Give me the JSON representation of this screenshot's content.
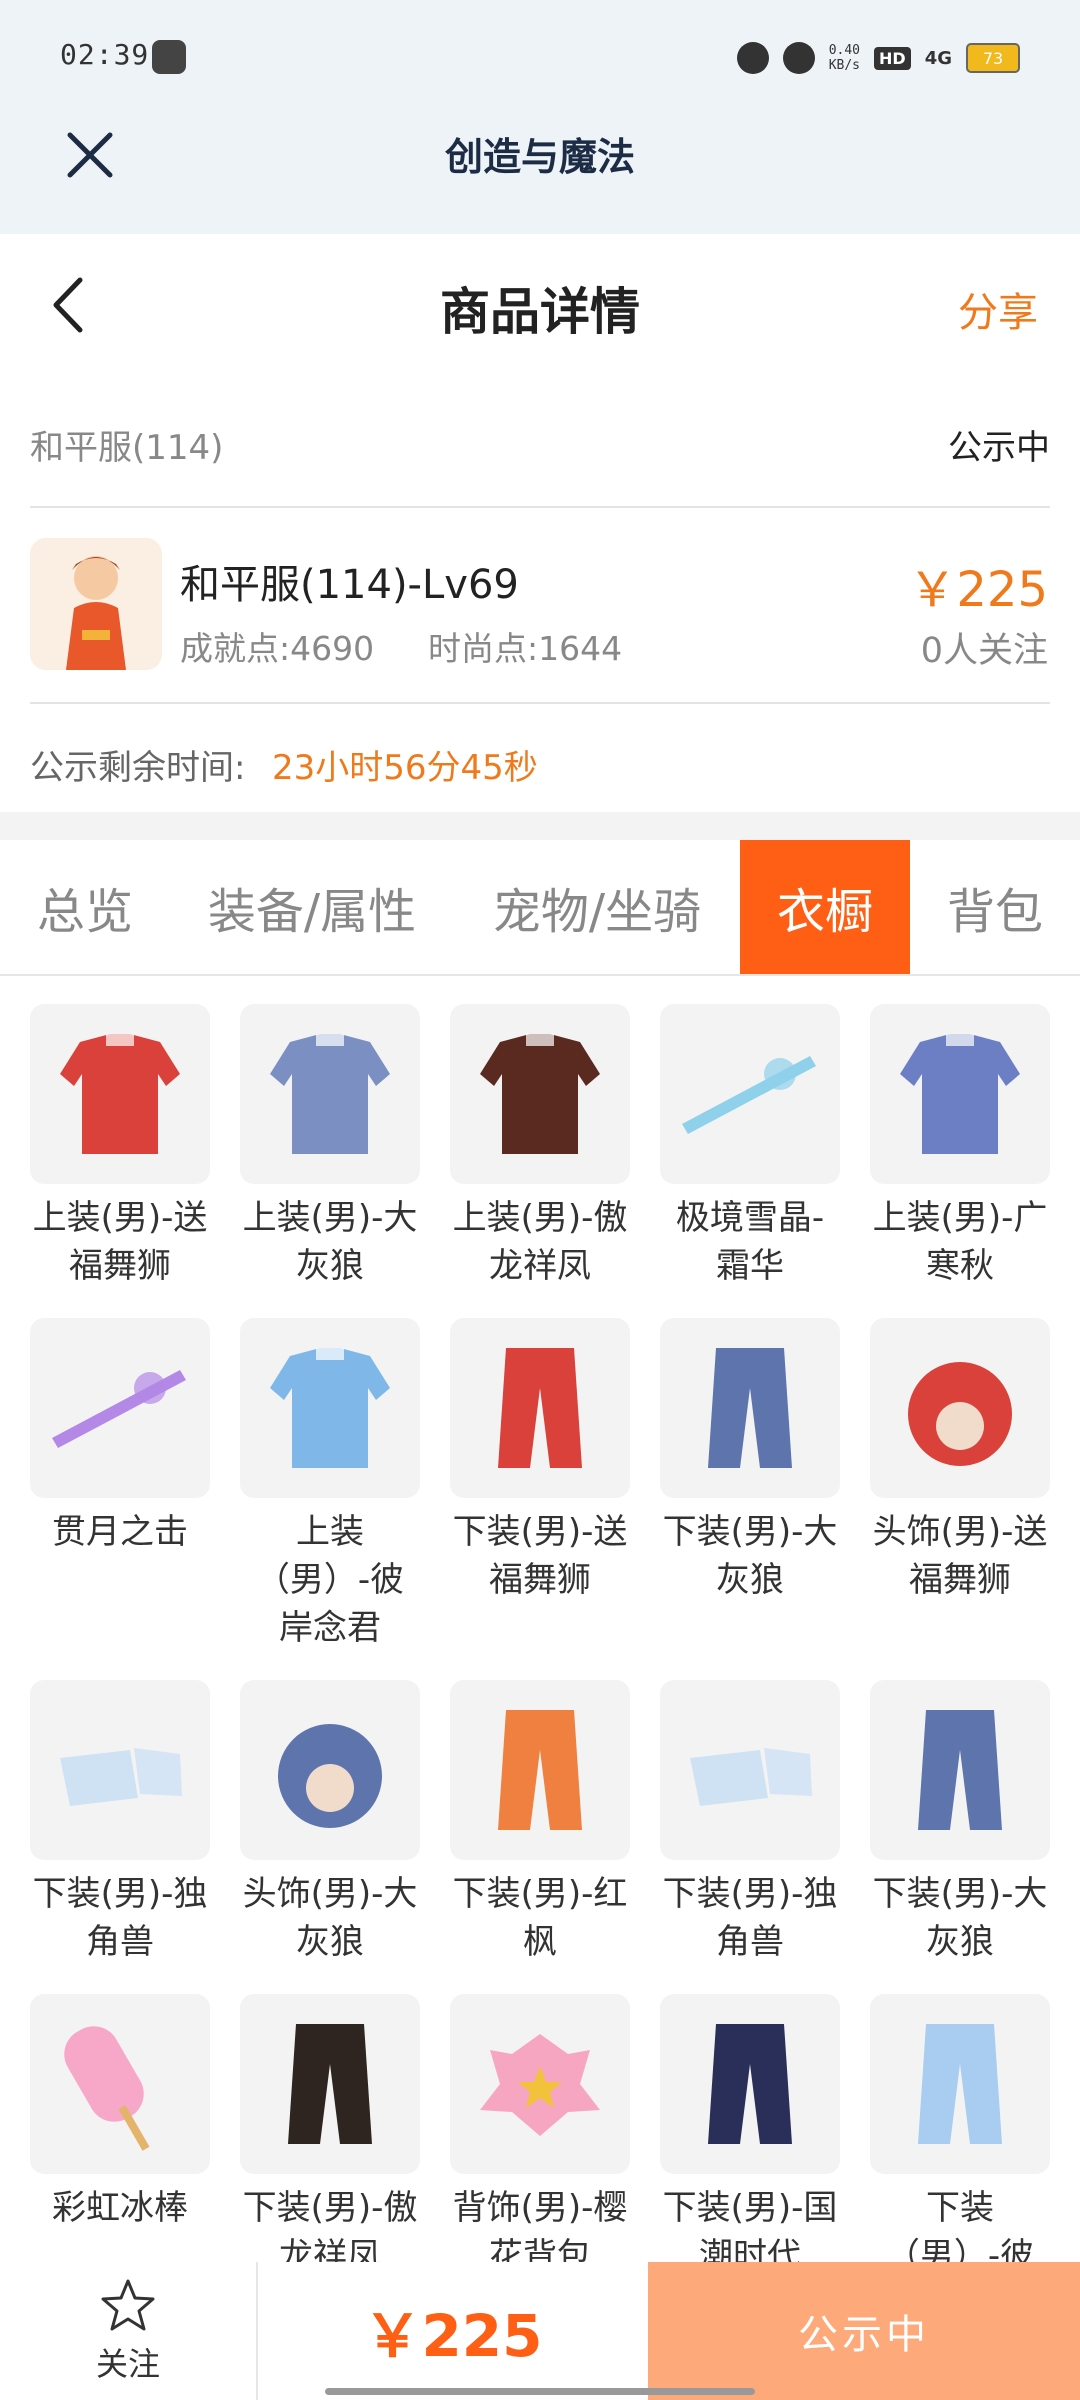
{
  "status_bar": {
    "time": "02:39",
    "net_speed_top": "0.40",
    "net_speed_unit": "KB/s",
    "hd": "HD",
    "network": "4G",
    "battery": "73"
  },
  "app_header": {
    "title": "创造与魔法"
  },
  "nav": {
    "title": "商品详情",
    "share": "分享"
  },
  "listing": {
    "server": "和平服(114)",
    "status": "公示中",
    "char_name": "和平服(114)-Lv69",
    "achievement": "成就点:4690",
    "fashion": "时尚点:1644",
    "price": "￥225",
    "followers": "0人关注",
    "time_label": "公示剩余时间:",
    "time_value": "23小时56分45秒"
  },
  "tabs": [
    {
      "label": "总览",
      "active": false
    },
    {
      "label": "装备/属性",
      "active": false
    },
    {
      "label": "宠物/坐骑",
      "active": false
    },
    {
      "label": "衣橱",
      "active": true
    },
    {
      "label": "背包",
      "active": false
    }
  ],
  "items": [
    {
      "name": "上装(男)-送\n福舞狮",
      "icon": "lion-top-icon",
      "color": "#d9413a"
    },
    {
      "name": "上装(男)-大\n灰狼",
      "icon": "wolf-top-icon",
      "color": "#7b8fc2"
    },
    {
      "name": "上装(男)-傲\n龙祥凤",
      "icon": "dragon-robe-icon",
      "color": "#5a2a20"
    },
    {
      "name": "极境雪晶-\n霜华",
      "icon": "ice-bow-icon",
      "color": "#8fd0ea"
    },
    {
      "name": "上装(男)-广\n寒秋",
      "icon": "autumn-robe-icon",
      "color": "#6c7fc4"
    },
    {
      "name": "贯月之击",
      "icon": "moon-weapon-icon",
      "color": "#b388e6"
    },
    {
      "name": "上装\n（男）-彼\n岸念君",
      "icon": "blue-robe-icon",
      "color": "#7fb8e8"
    },
    {
      "name": "下装(男)-送\n福舞狮",
      "icon": "lion-pants-icon",
      "color": "#d9413a"
    },
    {
      "name": "下装(男)-大\n灰狼",
      "icon": "wolf-pants-icon",
      "color": "#5e74ad"
    },
    {
      "name": "头饰(男)-送\n福舞狮",
      "icon": "lion-head-icon",
      "color": "#d9413a"
    },
    {
      "name": "下装(男)-独\n角兽",
      "icon": "unicorn-boots-icon",
      "color": "#cfe2f4"
    },
    {
      "name": "头饰(男)-大\n灰狼",
      "icon": "wolf-head-icon",
      "color": "#5e74ad"
    },
    {
      "name": "下装(男)-红\n枫",
      "icon": "maple-pants-icon",
      "color": "#f08040"
    },
    {
      "name": "下装(男)-独\n角兽",
      "icon": "unicorn-boots-icon",
      "color": "#cfe2f4"
    },
    {
      "name": "下装(男)-大\n灰狼",
      "icon": "wolf-pants-icon",
      "color": "#5e74ad"
    },
    {
      "name": "彩虹冰棒",
      "icon": "rainbow-popsicle-icon",
      "color": "#f7a8c8"
    },
    {
      "name": "下装(男)-傲\n龙祥凤",
      "icon": "dragon-pants-icon",
      "color": "#2e2420"
    },
    {
      "name": "背饰(男)-樱\n花背包",
      "icon": "sakura-backpack-icon",
      "color": "#f6a6c0"
    },
    {
      "name": "下装(男)-国\n潮时代",
      "icon": "trend-pants-icon",
      "color": "#2a2f5a"
    },
    {
      "name": "下装\n（男）-彼",
      "icon": "light-blue-pants-icon",
      "color": "#a8cdf0"
    }
  ],
  "bottom_bar": {
    "follow": "关注",
    "price": "￥225",
    "status": "公示中"
  }
}
